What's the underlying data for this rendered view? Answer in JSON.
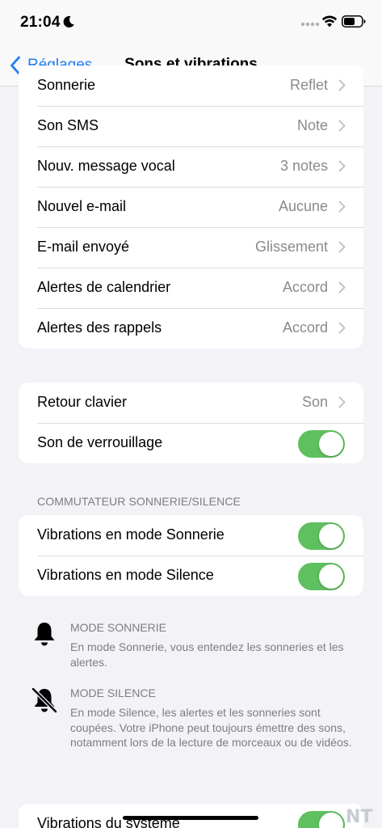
{
  "status_bar": {
    "time": "21:04",
    "icons": [
      "moon-icon",
      "signal-dots-icon",
      "wifi-icon",
      "battery-icon"
    ]
  },
  "nav": {
    "back_label": "Réglages",
    "title": "Sons et vibrations"
  },
  "sounds_group": [
    {
      "label": "Sonnerie",
      "value": "Reflet"
    },
    {
      "label": "Son SMS",
      "value": "Note"
    },
    {
      "label": "Nouv. message vocal",
      "value": "3 notes"
    },
    {
      "label": "Nouvel e-mail",
      "value": "Aucune"
    },
    {
      "label": "E-mail envoyé",
      "value": "Glissement"
    },
    {
      "label": "Alertes de calendrier",
      "value": "Accord"
    },
    {
      "label": "Alertes des rappels",
      "value": "Accord"
    }
  ],
  "keyboard_group": {
    "keyboard": {
      "label": "Retour clavier",
      "value": "Son"
    },
    "lock_sound": {
      "label": "Son de verrouillage",
      "on": true
    }
  },
  "switch_section": {
    "header": "COMMUTATEUR SONNERIE/SILENCE",
    "ring_vibrate": {
      "label": "Vibrations en mode Sonnerie",
      "on": true
    },
    "silent_vibrate": {
      "label": "Vibrations en mode Silence",
      "on": true
    }
  },
  "info": {
    "ring": {
      "icon": "bell-icon",
      "title": "MODE SONNERIE",
      "text": "En mode Sonnerie, vous entendez les sonneries et les alertes."
    },
    "silent": {
      "icon": "bell-slash-icon",
      "title": "MODE SILENCE",
      "text": "En mode Silence, les alertes et les sonneries sont coupées. Votre iPhone peut toujours émettre des sons, notamment lors de la lecture de morceaux ou de vidéos."
    }
  },
  "system_group": {
    "system_haptics": {
      "label": "Vibrations du système",
      "on": true
    }
  },
  "watermark": "NT",
  "colors": {
    "accent": "#1f7cf1",
    "toggle_on": "#5fc05f",
    "background": "#f2f2f7",
    "secondary_text": "#8a8a8e"
  }
}
